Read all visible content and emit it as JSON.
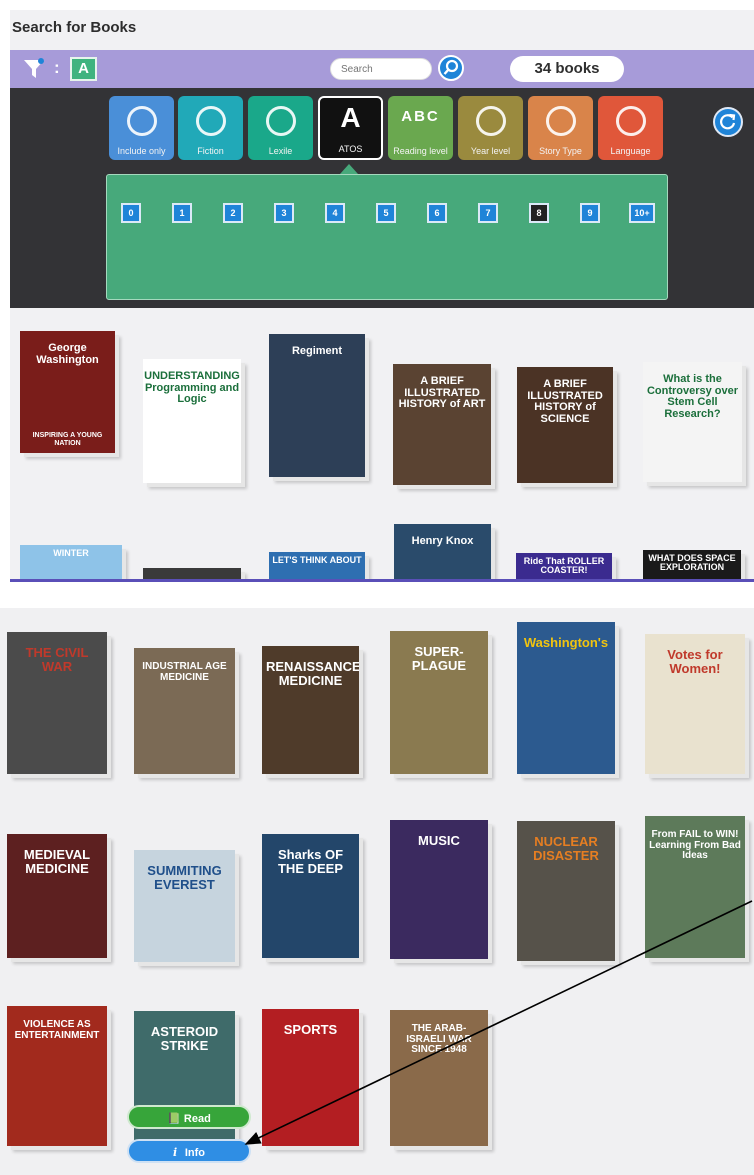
{
  "app": {
    "title": "Search for Books"
  },
  "toolbar": {
    "filter_chip": "A",
    "search_placeholder": "Search",
    "count": "34 books"
  },
  "categories": [
    {
      "label": "Include only",
      "color": "#4a8fd8",
      "icon": "magnifier-icon"
    },
    {
      "label": "Fiction",
      "color": "#21a9b8",
      "icon": "unicorn-icon"
    },
    {
      "label": "Lexile",
      "color": "#1aa88a",
      "icon": "lexile-icon"
    },
    {
      "label": "ATOS",
      "color": "#111111",
      "icon": "a-letter-icon",
      "glyph": "A",
      "active": true
    },
    {
      "label": "Reading level",
      "color": "#6aa84f",
      "icon": "abc-blocks-icon",
      "glyph": "ABC"
    },
    {
      "label": "Year level",
      "color": "#9a8a3e",
      "icon": "children-icon"
    },
    {
      "label": "Story Type",
      "color": "#d9844a",
      "icon": "pages-icon"
    },
    {
      "label": "Language",
      "color": "#e0573a",
      "icon": "speech-face-icon"
    }
  ],
  "levels": [
    "0",
    "1",
    "2",
    "3",
    "4",
    "5",
    "6",
    "7",
    "8",
    "9",
    "10+"
  ],
  "selected_level": "8",
  "panel1_books": [
    {
      "title": "George Washington",
      "subtitle": "INSPIRING A YOUNG NATION",
      "bg": "#7a1d1a"
    },
    {
      "title": "UNDERSTANDING Programming and Logic",
      "bg": "#ffffff"
    },
    {
      "title": "Regiment",
      "bg": "#2d3f57"
    },
    {
      "title": "A BRIEF ILLUSTRATED HISTORY of ART",
      "bg": "#5a4332"
    },
    {
      "title": "A BRIEF ILLUSTRATED HISTORY of SCIENCE",
      "bg": "#4b3325"
    },
    {
      "title": "What is the Controversy over Stem Cell Research?",
      "bg": "#f4f4f4"
    },
    {
      "title": "WINTER",
      "bg": "#8ec3e8"
    },
    {
      "title": "",
      "bg": "#3a3a3a"
    },
    {
      "title": "LET'S THINK ABOUT",
      "bg": "#2e6fb1"
    },
    {
      "title": "Henry Knox",
      "bg": "#2a4b6b"
    },
    {
      "title": "Ride That ROLLER COASTER!",
      "bg": "#3b2b8f"
    },
    {
      "title": "WHAT DOES SPACE EXPLORATION",
      "bg": "#1a1a1a"
    }
  ],
  "panel2_books": [
    {
      "title": "THE CIVIL WAR",
      "bg": "#4b4b4b",
      "accent": "#c0392b"
    },
    {
      "title": "INDUSTRIAL AGE MEDICINE",
      "bg": "#7b6a55",
      "accent": "#ffffff"
    },
    {
      "title": "RENAISSANCE MEDICINE",
      "bg": "#4f3b2a",
      "accent": "#ffffff"
    },
    {
      "title": "SUPER-PLAGUE",
      "bg": "#8a7a50",
      "accent": "#ffffff"
    },
    {
      "title": "Washington's",
      "bg": "#2c5a8f",
      "accent": "#f1c40f"
    },
    {
      "title": "Votes for Women!",
      "bg": "#e9e2cf",
      "accent": "#c0392b"
    },
    {
      "title": "MEDIEVAL MEDICINE",
      "bg": "#5d2020",
      "accent": "#ffffff"
    },
    {
      "title": "SUMMITING EVEREST",
      "bg": "#c6d4de",
      "accent": "#1f4f8a"
    },
    {
      "title": "Sharks OF THE DEEP",
      "bg": "#23466a",
      "accent": "#ffffff"
    },
    {
      "title": "MUSIC",
      "bg": "#3b2a5f",
      "accent": "#ffffff"
    },
    {
      "title": "NUCLEAR DISASTER",
      "bg": "#56524a",
      "accent": "#e67e22"
    },
    {
      "title": "From FAIL to WIN! Learning From Bad Ideas",
      "bg": "#5d7a5a",
      "accent": "#ffffff"
    },
    {
      "title": "VIOLENCE AS ENTERTAINMENT",
      "bg": "#a22a1d",
      "accent": "#ffffff"
    },
    {
      "title": "ASTEROID STRIKE",
      "bg": "#3f6b6a",
      "accent": "#ffffff"
    },
    {
      "title": "SPORTS",
      "bg": "#b31e22",
      "accent": "#ffffff"
    },
    {
      "title": "THE ARAB-ISRAELI WAR SINCE 1948",
      "bg": "#8a6a4a",
      "accent": "#ffffff"
    }
  ],
  "actions": {
    "read_label": "Read",
    "info_label": "Info"
  }
}
